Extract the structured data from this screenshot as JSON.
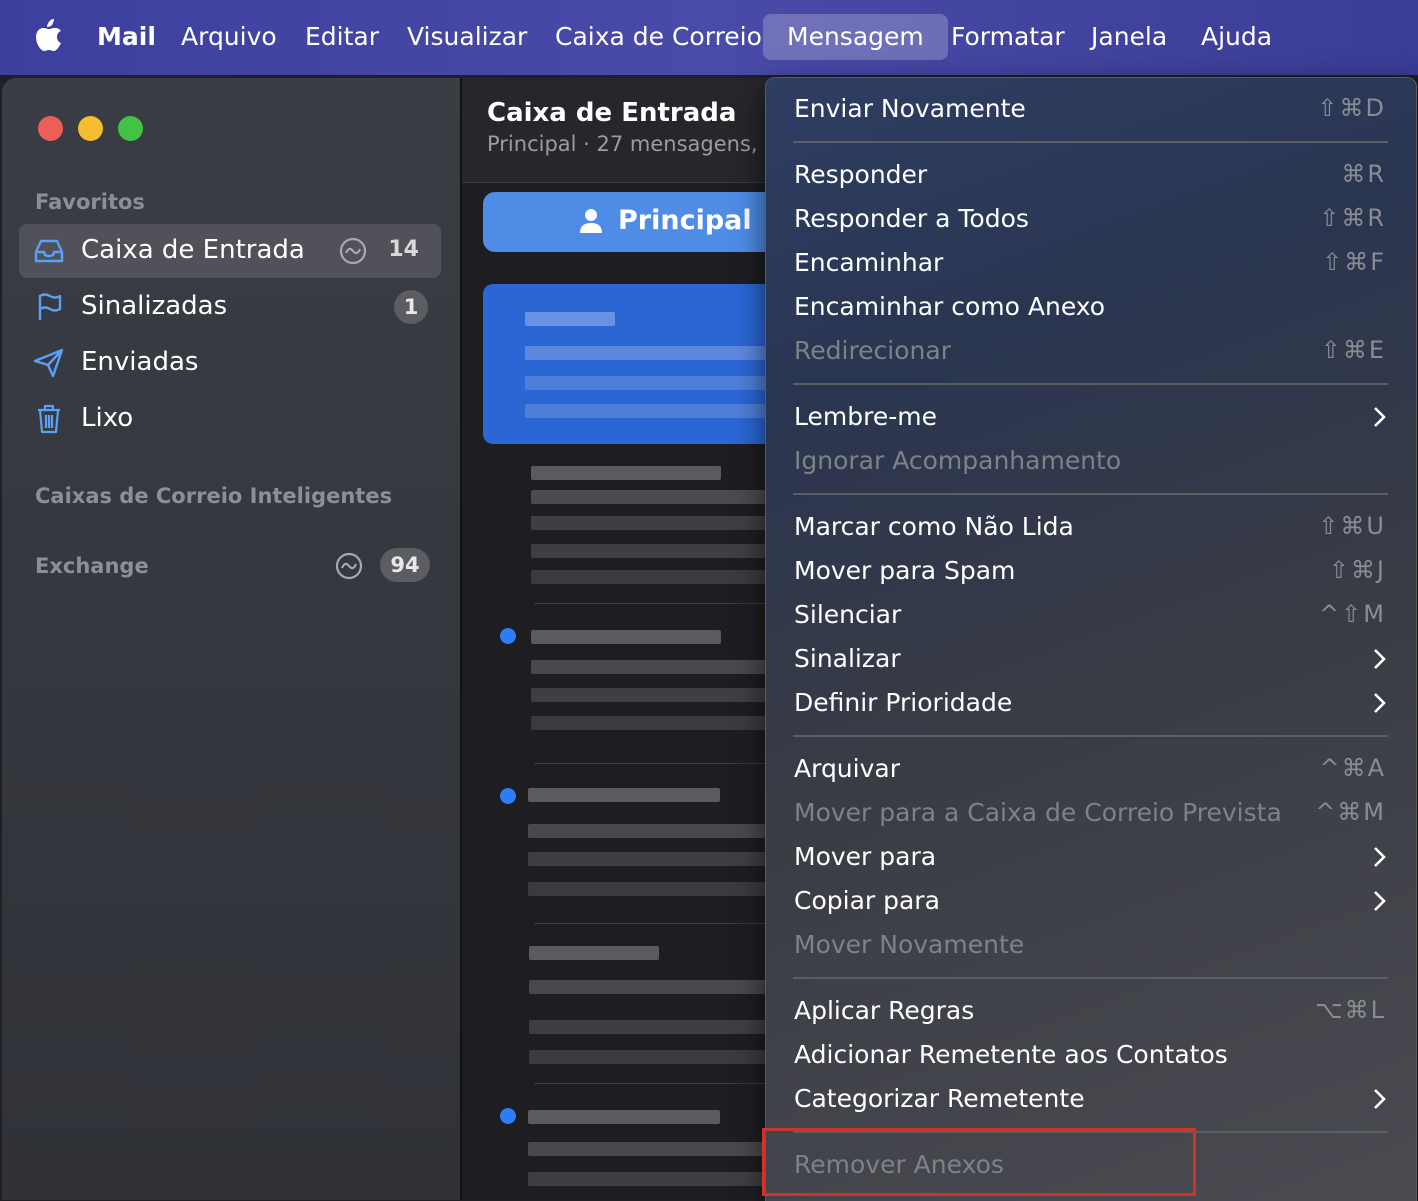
{
  "menubar": {
    "app_name": "Mail",
    "items": [
      "Arquivo",
      "Editar",
      "Visualizar",
      "Caixa de Correio",
      "Mensagem",
      "Formatar",
      "Janela",
      "Ajuda"
    ],
    "active": "Mensagem"
  },
  "sidebar": {
    "favorites_header": "Favoritos",
    "items": [
      {
        "label": "Caixa de Entrada",
        "count": "14",
        "icon": "inbox-icon"
      },
      {
        "label": "Sinalizadas",
        "count": "1",
        "icon": "flag-icon"
      },
      {
        "label": "Enviadas",
        "icon": "paperplane-icon"
      },
      {
        "label": "Lixo",
        "icon": "trash-icon"
      }
    ],
    "smart_header": "Caixas de Correio Inteligentes",
    "exchange_header": "Exchange",
    "exchange_count": "94"
  },
  "list": {
    "title": "Caixa de Entrada",
    "subtitle": "Principal · 27 mensagens, ",
    "tab_label": "Principal"
  },
  "menu": {
    "items": [
      {
        "label": "Enviar Novamente",
        "shortcut": "⇧⌘D"
      },
      {
        "label": "Responder",
        "shortcut": "⌘R"
      },
      {
        "label": "Responder a Todos",
        "shortcut": "⇧⌘R"
      },
      {
        "label": "Encaminhar",
        "shortcut": "⇧⌘F"
      },
      {
        "label": "Encaminhar como Anexo"
      },
      {
        "label": "Redirecionar",
        "shortcut": "⇧⌘E",
        "disabled": true
      },
      {
        "label": "Lembre-me",
        "submenu": true
      },
      {
        "label": "Ignorar Acompanhamento",
        "disabled": true
      },
      {
        "label": "Marcar como Não Lida",
        "shortcut": "⇧⌘U"
      },
      {
        "label": "Mover para Spam",
        "shortcut": "⇧⌘J"
      },
      {
        "label": "Silenciar",
        "shortcut": "^⇧M"
      },
      {
        "label": "Sinalizar",
        "submenu": true
      },
      {
        "label": "Definir Prioridade",
        "submenu": true
      },
      {
        "label": "Arquivar",
        "shortcut": "^⌘A"
      },
      {
        "label": "Mover para a Caixa de Correio Prevista",
        "shortcut": "^⌘M",
        "disabled": true
      },
      {
        "label": "Mover para",
        "submenu": true
      },
      {
        "label": "Copiar para",
        "submenu": true
      },
      {
        "label": "Mover Novamente",
        "disabled": true
      },
      {
        "label": "Aplicar Regras",
        "shortcut": "⌥⌘L"
      },
      {
        "label": "Adicionar Remetente aos Contatos"
      },
      {
        "label": "Categorizar Remetente",
        "submenu": true
      },
      {
        "label": "Remover Anexos",
        "disabled": true
      }
    ]
  },
  "colors": {
    "accent": "#2a66d4",
    "highlight_border": "#d0332b",
    "unread_dot": "#2f7bf5"
  }
}
